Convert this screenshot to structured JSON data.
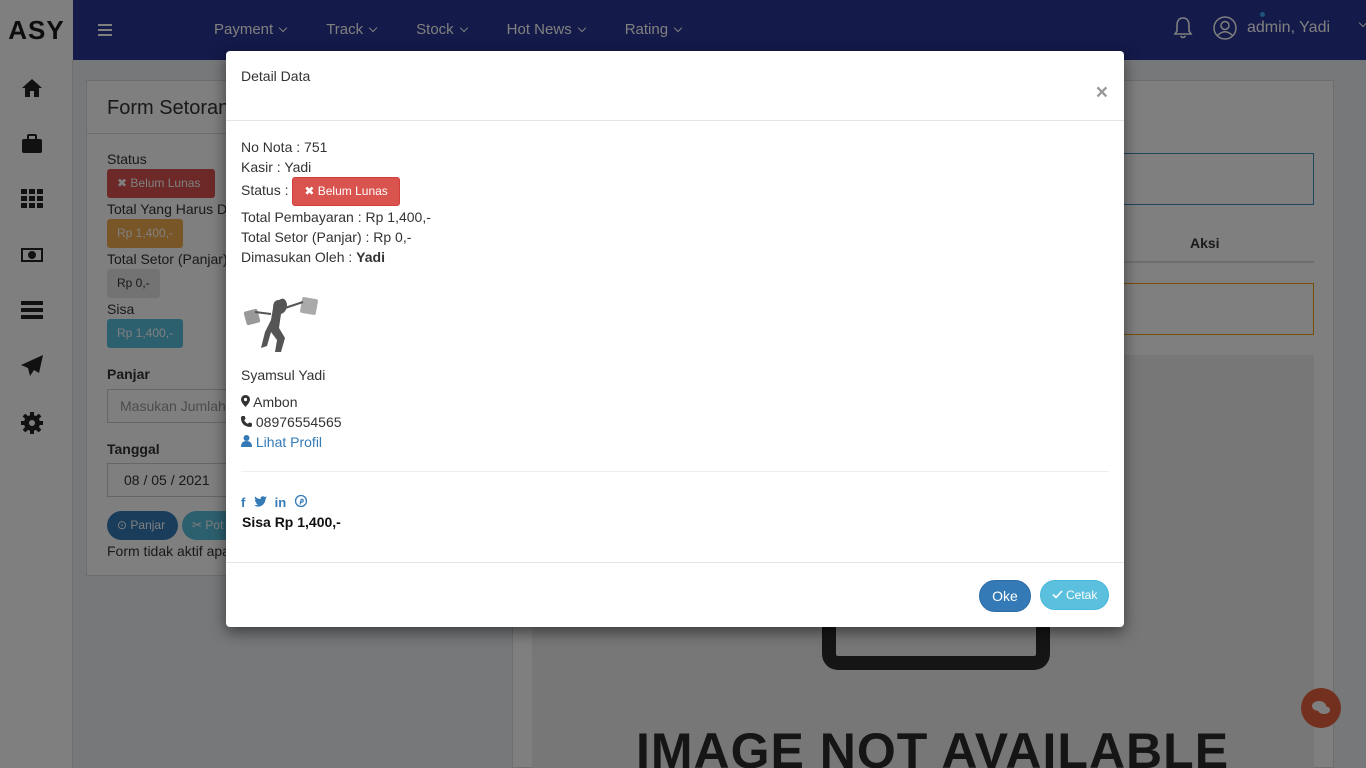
{
  "brand": "ASY",
  "navbar": {
    "menu": [
      "Payment",
      "Track",
      "Stock",
      "Hot News",
      "Rating"
    ],
    "user": "admin, Yadi"
  },
  "sidebar": {
    "icons": [
      "home-icon",
      "briefcase-icon",
      "grid-icon",
      "money-icon",
      "server-icon",
      "paper-plane-icon",
      "gear-icon"
    ]
  },
  "background_form": {
    "title": "Form Setoran",
    "status_label": "Status",
    "status_badge": "Belum Lunas",
    "total_harus_label": "Total Yang Harus D",
    "total_harus_value": "Rp 1,400,-",
    "total_setor_label": "Total Setor (Panjar)",
    "total_setor_value": "Rp 0,-",
    "sisa_label": "Sisa",
    "sisa_value": "Rp 1,400,-",
    "panjar_label": "Panjar",
    "panjar_placeholder": "Masukan Jumlah",
    "tanggal_label": "Tanggal",
    "tanggal_value": "08 / 05 / 2021",
    "btn_panjar": "Panjar",
    "btn_pot": "Pot",
    "note": "Form tidak aktif apa"
  },
  "background_right": {
    "aksi_header": "Aksi",
    "image_text": "IMAGE NOT AVAILABLE"
  },
  "modal": {
    "title": "Detail Data",
    "close": "×",
    "no_nota": "No Nota : 751",
    "kasir": "Kasir : Yadi",
    "status_label": "Status :",
    "status_badge": "Belum Lunas",
    "total_pembayaran": "Total Pembayaran : Rp 1,400,-",
    "total_setor": "Total Setor (Panjar) : Rp 0,-",
    "dimasukan_label": "Dimasukan Oleh :",
    "dimasukan_value": "Yadi",
    "name": "Syamsul Yadi",
    "location": "Ambon",
    "phone": "08976554565",
    "profile_link": "Lihat Profil",
    "sisa": "Sisa Rp 1,400,-",
    "btn_oke": "Oke",
    "btn_cetak": "Cetak"
  },
  "colors": {
    "navbar": "#283592",
    "danger": "#d9534f",
    "warning": "#f0ad4e",
    "info": "#5bc0de",
    "primary": "#337ab7",
    "fab": "#e8603c"
  }
}
